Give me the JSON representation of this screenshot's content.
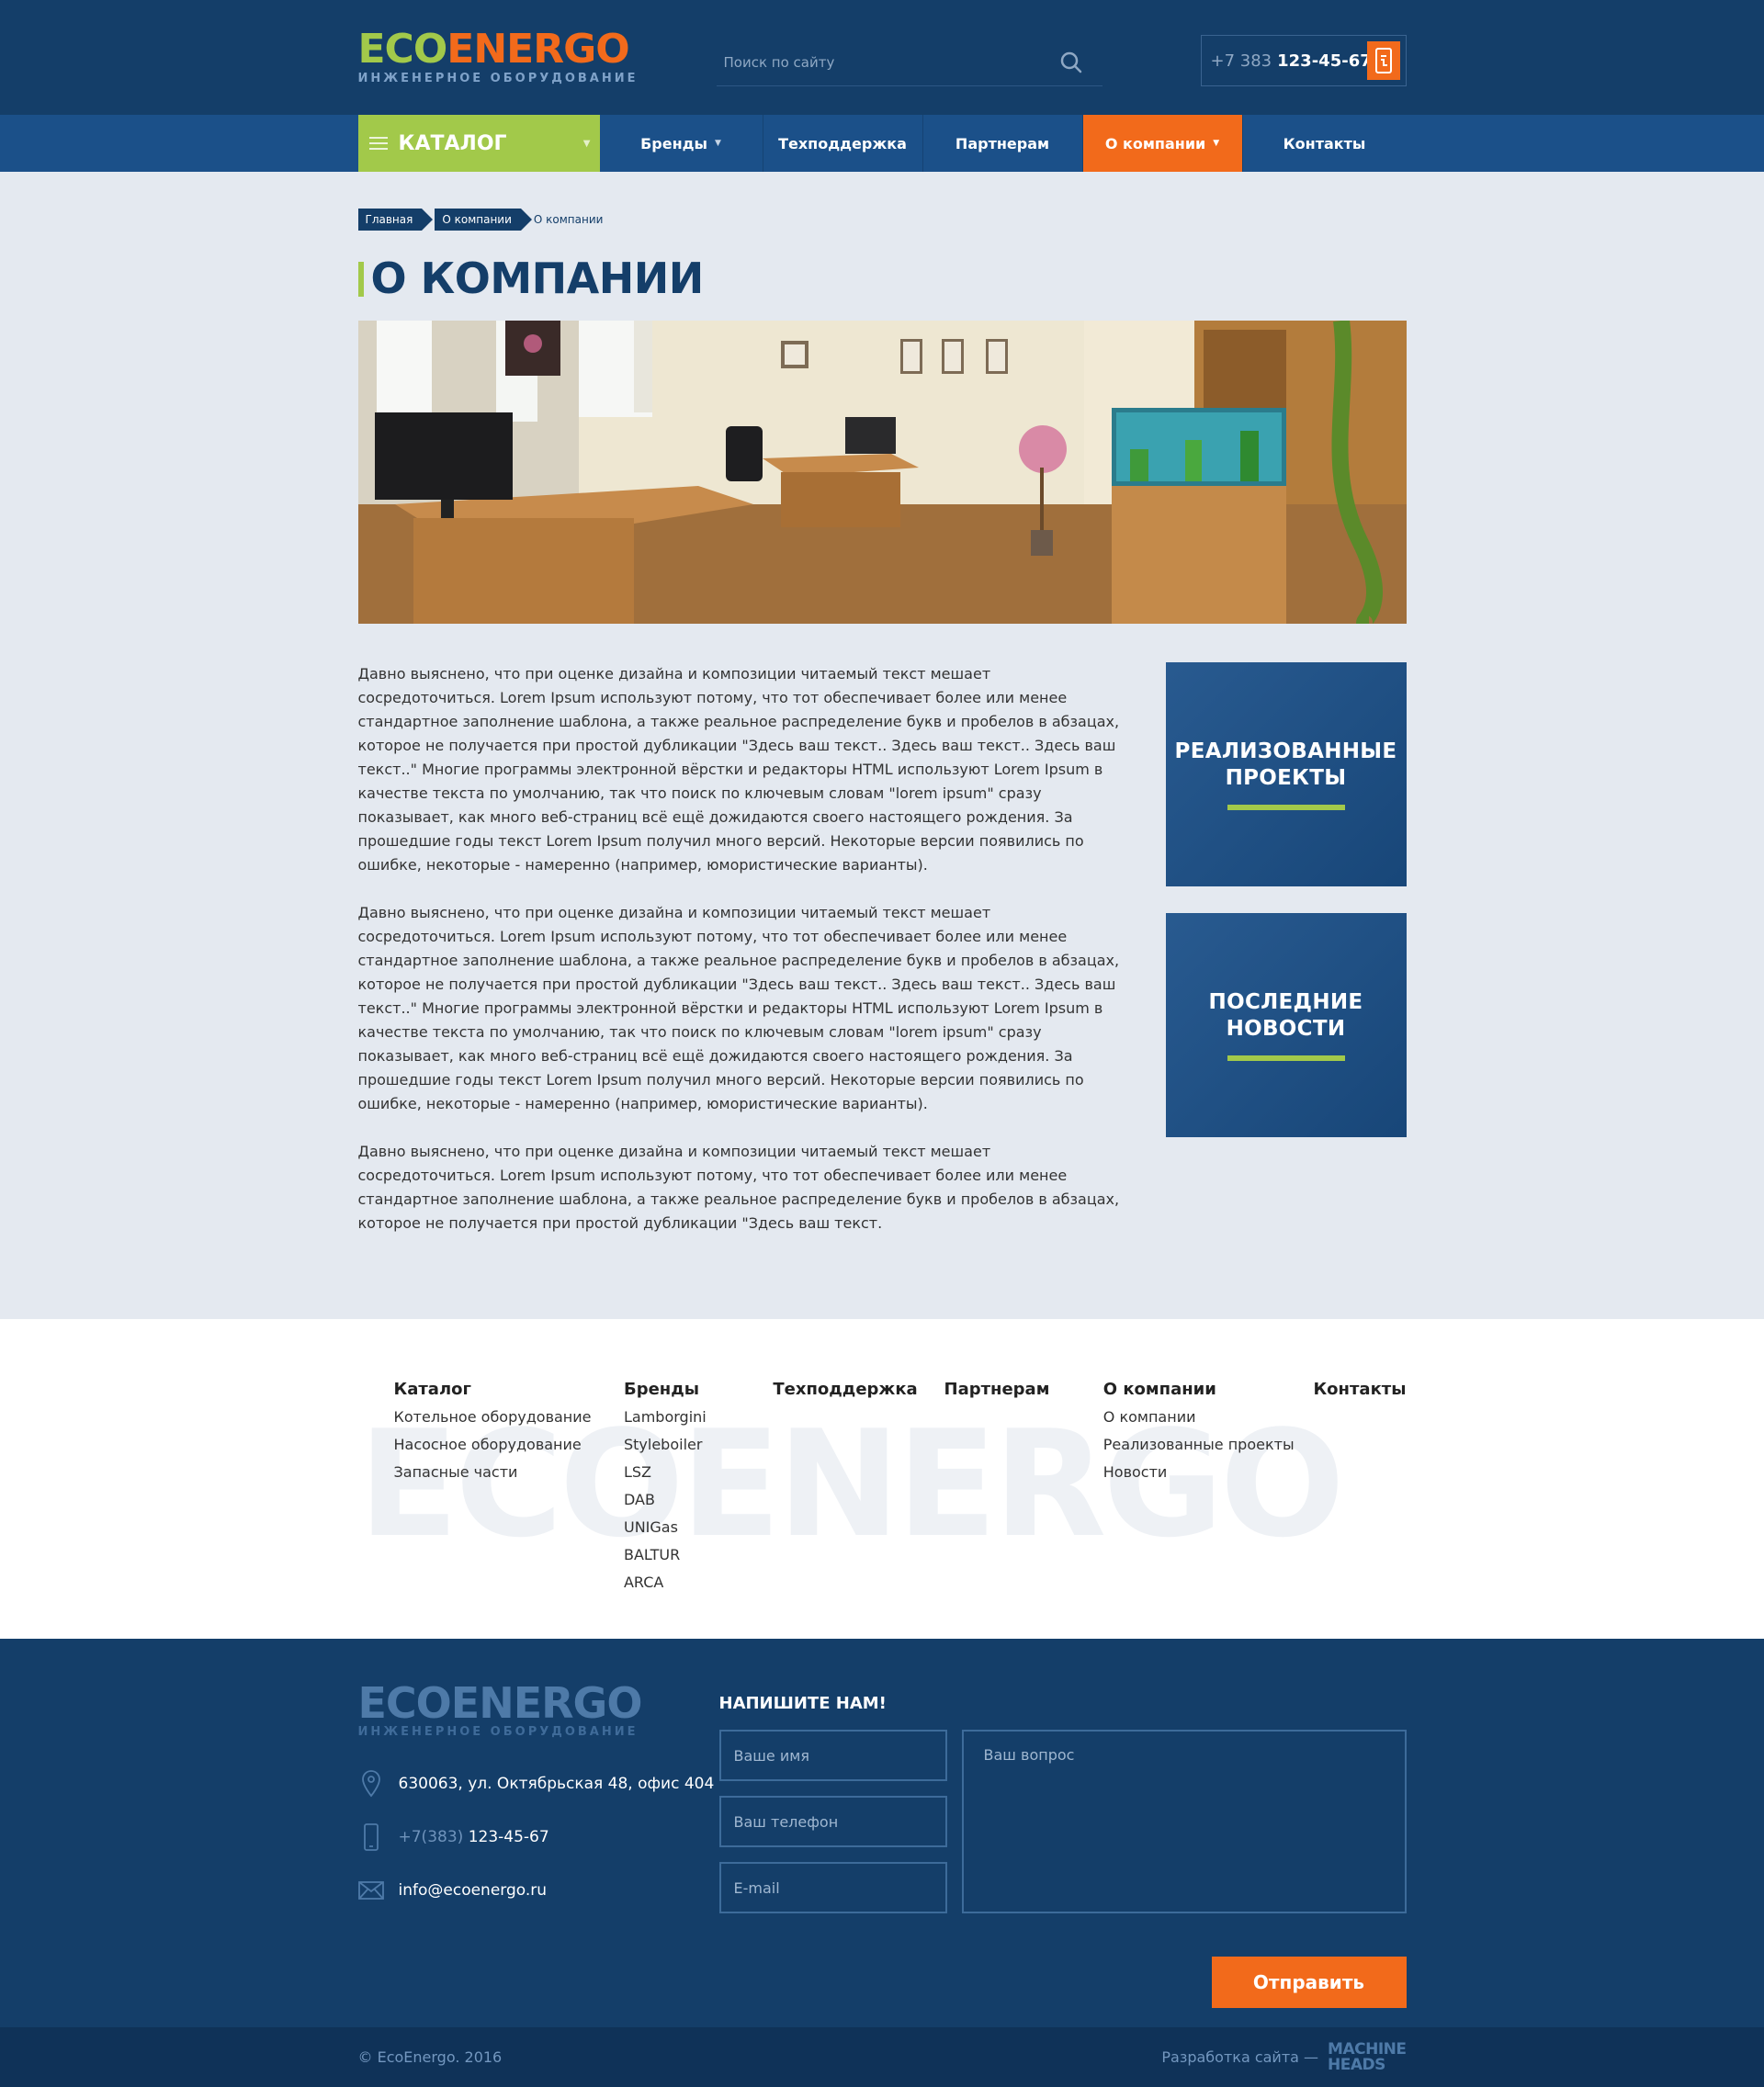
{
  "header": {
    "logo_eco": "ECO",
    "logo_energo": "ENERGO",
    "logo_sub": "ИНЖЕНЕРНОЕ ОБОРУДОВАНИЕ",
    "search_placeholder": "Поиск по сайту",
    "phone_code": "+7 383",
    "phone_number": "123-45-67"
  },
  "nav": {
    "catalog": "КАТАЛОГ",
    "items": [
      {
        "label": "Бренды",
        "dropdown": true
      },
      {
        "label": "Техподдержка",
        "dropdown": false
      },
      {
        "label": "Партнерам",
        "dropdown": false
      },
      {
        "label": "О компании",
        "dropdown": true,
        "active": true
      },
      {
        "label": "Контакты",
        "dropdown": false
      }
    ]
  },
  "breadcrumbs": [
    "Главная",
    "О компании",
    "О компании"
  ],
  "page_title": "О КОМПАНИИ",
  "paragraphs": [
    "Давно выяснено, что при оценке дизайна и композиции читаемый текст мешает сосредоточиться. Lorem Ipsum используют потому, что тот обеспечивает более или менее стандартное заполнение шаблона, а также реальное распределение букв и пробелов в абзацах, которое не получается при простой дубликации \"Здесь ваш текст.. Здесь ваш текст.. Здесь ваш текст..\" Многие программы электронной вёрстки и редакторы HTML используют Lorem Ipsum в качестве текста по умолчанию, так что поиск по ключевым словам \"lorem ipsum\" сразу показывает, как много веб-страниц всё ещё дожидаются своего настоящего рождения. За прошедшие годы текст Lorem Ipsum получил много версий. Некоторые версии появились по ошибке, некоторые - намеренно (например, юмористические варианты).",
    "Давно выяснено, что при оценке дизайна и композиции читаемый текст мешает сосредоточиться. Lorem Ipsum используют потому, что тот обеспечивает более или менее стандартное заполнение шаблона, а также реальное распределение букв и пробелов в абзацах, которое не получается при простой дубликации \"Здесь ваш текст.. Здесь ваш текст.. Здесь ваш текст..\" Многие программы электронной вёрстки и редакторы HTML используют Lorem Ipsum в качестве текста по умолчанию, так что поиск по ключевым словам \"lorem ipsum\" сразу показывает, как много веб-страниц всё ещё дожидаются своего настоящего рождения. За прошедшие годы текст Lorem Ipsum получил много версий. Некоторые версии появились по ошибке, некоторые - намеренно (например, юмористические варианты).",
    "Давно выяснено, что при оценке дизайна и композиции читаемый текст мешает сосредоточиться. Lorem Ipsum используют потому, что тот обеспечивает более или менее стандартное заполнение шаблона, а также реальное распределение букв и пробелов в абзацах, которое не получается при простой дубликации \"Здесь ваш текст."
  ],
  "tiles": [
    {
      "line1": "РЕАЛИЗОВАННЫЕ",
      "line2": "ПРОЕКТЫ"
    },
    {
      "line1": "ПОСЛЕДНИЕ",
      "line2": "НОВОСТИ"
    }
  ],
  "footer_columns": [
    {
      "title": "Каталог",
      "links": [
        "Котельное оборудование",
        "Насосное оборудование",
        "Запасные части"
      ]
    },
    {
      "title": "Бренды",
      "links": [
        "Lamborgini",
        "Styleboiler",
        "LSZ",
        "DAB",
        "UNIGas",
        "BALTUR",
        "ARCA"
      ]
    },
    {
      "title": "Техподдержка",
      "links": []
    },
    {
      "title": "Партнерам",
      "links": []
    },
    {
      "title": "О компании",
      "links": [
        "О компании",
        "Реализованные проекты",
        "Новости"
      ]
    },
    {
      "title": "Контакты",
      "links": []
    }
  ],
  "watermark": "ECOENERGO",
  "contact": {
    "address": "630063, ул. Октябрьская 48, офис 404",
    "phone_code": "+7(383)",
    "phone_number": "123-45-67",
    "email": "info@ecoenergo.ru",
    "form_title": "НАПИШИТЕ НАМ!",
    "name_placeholder": "Ваше имя",
    "phone_placeholder": "Ваш телефон",
    "email_placeholder": "E-mail",
    "question_placeholder": "Ваш вопрос",
    "submit": "Отправить"
  },
  "bottom": {
    "copyright": "© EcoEnergo. 2016",
    "dev_label": "Разработка сайта —",
    "dev_logo_1": "MACHINE",
    "dev_logo_2": "HEADS"
  },
  "colors": {
    "dark_blue": "#143e69",
    "nav_blue": "#1b5089",
    "green": "#a2c94a",
    "orange": "#f26a1b",
    "page_bg": "#e4e9f0"
  }
}
